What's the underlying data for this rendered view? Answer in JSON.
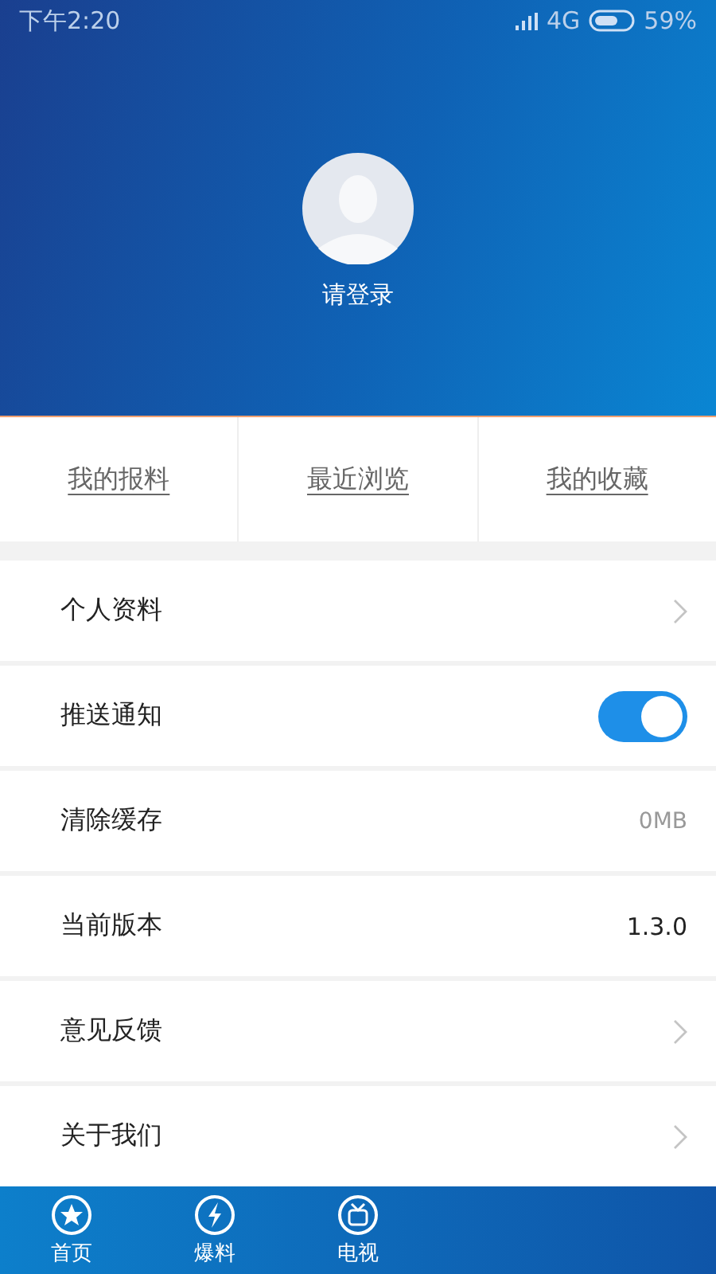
{
  "status_bar": {
    "time": "下午2:20",
    "network": "4G",
    "battery": "59%"
  },
  "profile": {
    "login": "请登录"
  },
  "shortcuts": [
    {
      "label": "我的报料"
    },
    {
      "label": "最近浏览"
    },
    {
      "label": "我的收藏"
    }
  ],
  "settings": [
    {
      "kind": "arrow",
      "label": "个人资料"
    },
    {
      "kind": "toggle",
      "label": "推送通知",
      "on": true
    },
    {
      "kind": "value",
      "label": "清除缓存",
      "value": "0MB",
      "muted": true
    },
    {
      "kind": "value",
      "label": "当前版本",
      "value": "1.3.0",
      "muted": false
    },
    {
      "kind": "arrow",
      "label": "意见反馈"
    },
    {
      "kind": "arrow",
      "label": "关于我们"
    }
  ],
  "tab_bar": [
    {
      "kind": "star",
      "label": "首页"
    },
    {
      "kind": "bolt",
      "label": "爆料"
    },
    {
      "kind": "tv",
      "label": "电视"
    }
  ]
}
